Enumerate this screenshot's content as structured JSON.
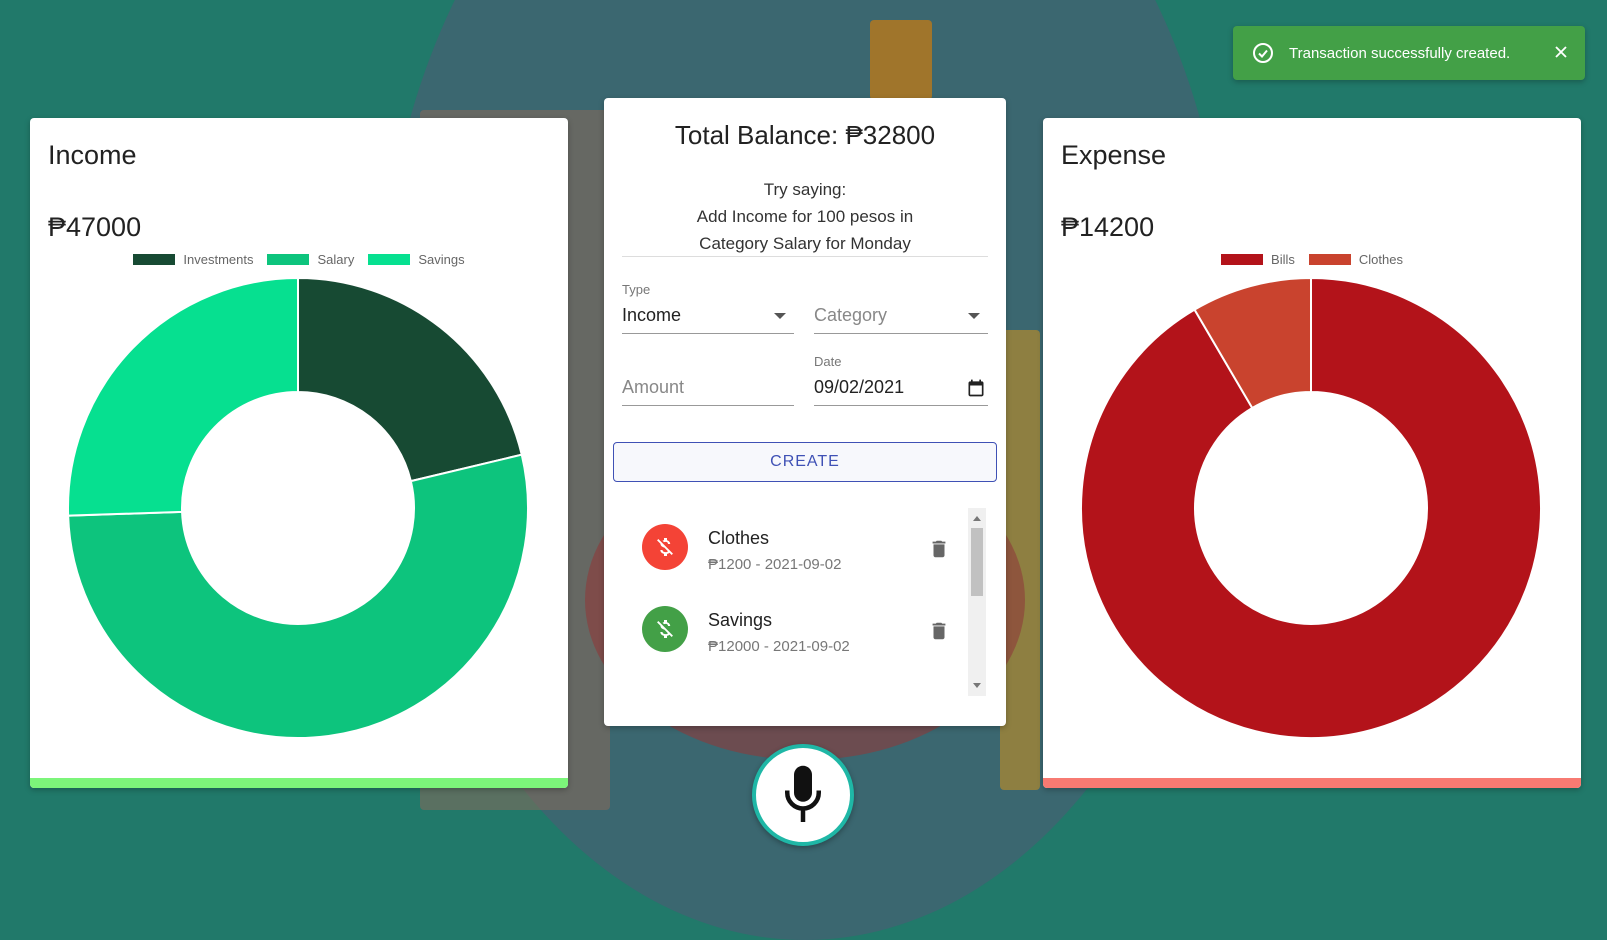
{
  "income": {
    "title": "Income",
    "amount": "₱47000",
    "accent": "#7cf57a"
  },
  "expense": {
    "title": "Expense",
    "amount": "₱14200",
    "accent": "#f77a72"
  },
  "center": {
    "balance": "Total Balance: ₱32800",
    "hint_line1": "Try saying:",
    "hint_line2": "Add Income for 100 pesos in",
    "hint_line3": "Category Salary for Monday",
    "type_label": "Type",
    "type_value": "Income",
    "category_placeholder": "Category",
    "amount_placeholder": "Amount",
    "date_label": "Date",
    "date_value": "09/02/2021",
    "create_label": "CREATE"
  },
  "transactions": [
    {
      "name": "Clothes",
      "meta": "₱1200 - 2021-09-02",
      "color": "#f44336",
      "icon": "money-off-icon"
    },
    {
      "name": "Savings",
      "meta": "₱12000 - 2021-09-02",
      "color": "#43a047",
      "icon": "money-off-icon"
    }
  ],
  "toast": {
    "message": "Transaction successfully created.",
    "icon": "check-circle-icon"
  },
  "chart_data": [
    {
      "type": "pie",
      "title": "",
      "categories": [
        "Investments",
        "Salary",
        "Savings"
      ],
      "values": [
        10000,
        25000,
        12000
      ],
      "colors": [
        "#174a33",
        "#0dc47d",
        "#06e090"
      ],
      "legend": "top"
    },
    {
      "type": "pie",
      "title": "",
      "categories": [
        "Bills",
        "Clothes"
      ],
      "values": [
        13000,
        1200
      ],
      "colors": [
        "#b3131a",
        "#c9432e"
      ],
      "legend": "top"
    }
  ]
}
